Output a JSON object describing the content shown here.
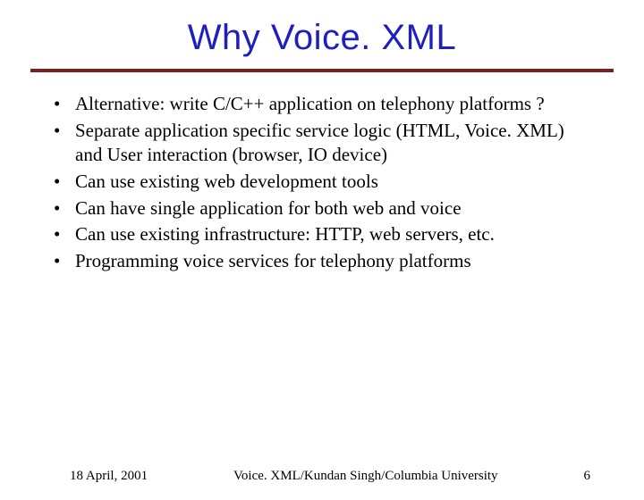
{
  "title": "Why Voice. XML",
  "bullets": [
    "Alternative: write C/C++ application on telephony platforms ?",
    "Separate application specific service logic (HTML, Voice. XML) and User interaction (browser, IO device)",
    "Can use existing web development tools",
    "Can have single application for both web and voice",
    "Can use existing infrastructure: HTTP, web servers, etc.",
    "Programming voice services for telephony platforms"
  ],
  "footer": {
    "date": "18 April, 2001",
    "center": "Voice. XML/Kundan Singh/Columbia University",
    "page": "6"
  }
}
